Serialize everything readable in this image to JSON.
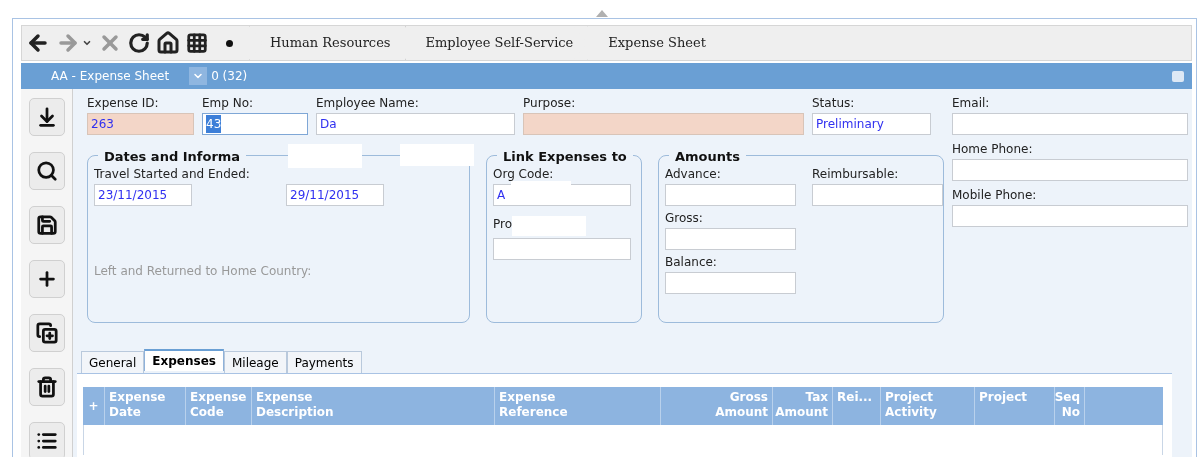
{
  "toolbar": {
    "breadcrumbs": [
      "Human Resources",
      "Employee Self-Service",
      "Expense Sheet"
    ]
  },
  "title_bar": {
    "title": "AA - Expense Sheet",
    "count": "0 (32)"
  },
  "sidebar": {
    "buttons": [
      {
        "kind": "download"
      },
      {
        "kind": "search"
      },
      {
        "kind": "save"
      },
      {
        "kind": "add"
      },
      {
        "kind": "copy"
      },
      {
        "kind": "delete"
      },
      {
        "kind": "list"
      }
    ]
  },
  "header_fields": [
    {
      "label": "Expense ID:",
      "value": "263",
      "kind": "readonly"
    },
    {
      "label": "Emp No:",
      "value": "43",
      "kind": "focused"
    },
    {
      "label": "Employee Name:",
      "value": "Da",
      "kind": "normal"
    },
    {
      "label": "Purpose:",
      "kind": "readonly"
    },
    {
      "label": "Status:",
      "value": "Preliminary",
      "kind": "normal"
    },
    {
      "label": "Email:",
      "kind": "normal"
    }
  ],
  "dates_group": {
    "title": "Dates and Informa",
    "travel_label": "Travel Started and Ended:",
    "start": "23/11/2015",
    "end": "29/11/2015",
    "home_country_label": "Left and Returned to Home Country:"
  },
  "link_group": {
    "title": "Link Expenses to",
    "org_label": "Org Code:",
    "org_value": "A",
    "project_label": "Pro"
  },
  "amounts_group": {
    "title": "Amounts",
    "fields": [
      {
        "label": "Advance:"
      },
      {
        "label": "Reimbursable:"
      },
      {
        "label": "Gross:"
      },
      {
        "label": "Balance:"
      }
    ]
  },
  "contact_fields": [
    {
      "label": "Home Phone:"
    },
    {
      "label": "Mobile Phone:"
    }
  ],
  "tabs": [
    {
      "label": "General",
      "selected": false
    },
    {
      "label": "Expenses",
      "selected": true
    },
    {
      "label": "Mileage",
      "selected": false
    },
    {
      "label": "Payments",
      "selected": false
    }
  ],
  "table": {
    "add": "+",
    "columns": [
      "Expense Date",
      "Expense Code",
      "Expense Description",
      "Expense Reference",
      "Gross Amount",
      "Tax Amount",
      "Rei...",
      "Project Activity",
      "Project",
      "Seq No"
    ]
  }
}
